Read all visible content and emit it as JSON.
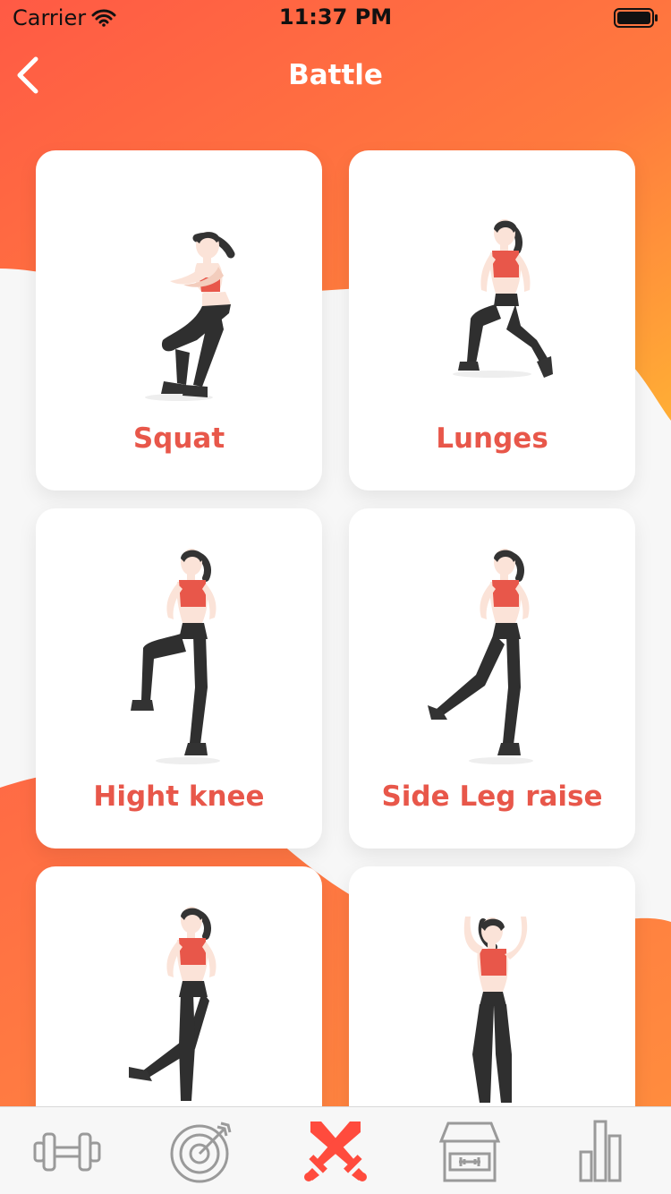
{
  "status": {
    "carrier": "Carrier",
    "time": "11:37 PM"
  },
  "nav": {
    "title": "Battle",
    "back_icon": "chevron-left-icon"
  },
  "colors": {
    "header_gradient_start": "#ff5d45",
    "header_gradient_end": "#ffa93a",
    "accent": "#e8574a",
    "tab_inactive": "#9a9a9a",
    "tab_active": "#ff4b3d"
  },
  "exercises": [
    {
      "label": "Squat",
      "pose": "squat"
    },
    {
      "label": "Lunges",
      "pose": "lunge"
    },
    {
      "label": "Hight knee",
      "pose": "high-knee"
    },
    {
      "label": "Side Leg raise",
      "pose": "side-leg"
    },
    {
      "label": "",
      "pose": "cross-leg"
    },
    {
      "label": "",
      "pose": "arms-up"
    }
  ],
  "tabs": [
    {
      "icon": "dumbbell-icon",
      "active": false
    },
    {
      "icon": "target-icon",
      "active": false
    },
    {
      "icon": "crossed-swords-icon",
      "active": true
    },
    {
      "icon": "gym-store-icon",
      "active": false
    },
    {
      "icon": "bar-chart-icon",
      "active": false
    }
  ]
}
